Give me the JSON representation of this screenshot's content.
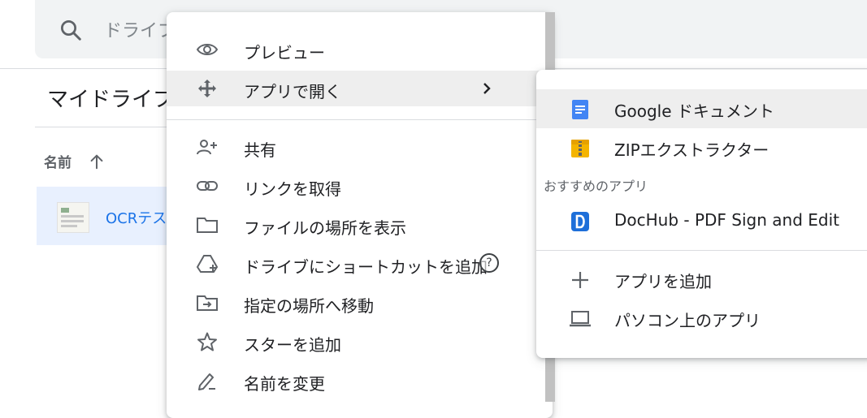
{
  "search": {
    "placeholder": "ドライブ"
  },
  "page": {
    "title": "マイドライブ"
  },
  "list": {
    "column_name": "名前",
    "files": [
      {
        "name": "OCRテスト"
      }
    ]
  },
  "context_menu": {
    "items": [
      {
        "label": "プレビュー",
        "icon": "eye-icon"
      },
      {
        "label": "アプリで開く",
        "icon": "move-icon",
        "submenu_arrow": "›"
      },
      {
        "label": "共有",
        "icon": "person-add-icon"
      },
      {
        "label": "リンクを取得",
        "icon": "link-icon"
      },
      {
        "label": "ファイルの場所を表示",
        "icon": "folder-icon"
      },
      {
        "label": "ドライブにショートカットを追加",
        "icon": "drive-shortcut-icon",
        "badge": "?"
      },
      {
        "label": "指定の場所へ移動",
        "icon": "folder-move-icon"
      },
      {
        "label": "スターを追加",
        "icon": "star-icon"
      },
      {
        "label": "名前を変更",
        "icon": "pencil-icon"
      }
    ]
  },
  "submenu": {
    "apps": [
      {
        "label": "Google ドキュメント",
        "icon": "google-docs-icon"
      },
      {
        "label": "ZIPエクストラクター",
        "icon": "zip-extractor-icon"
      }
    ],
    "suggested_heading": "おすすめのアプリ",
    "suggested": [
      {
        "label": "DocHub - PDF Sign and Edit",
        "icon": "dochub-icon"
      }
    ],
    "actions": [
      {
        "label": "アプリを追加",
        "icon": "plus-icon"
      },
      {
        "label": "パソコン上のアプリ",
        "icon": "laptop-icon"
      }
    ]
  },
  "colors": {
    "accent": "#1a73e8",
    "hover": "#eeeeee",
    "icon_gray": "#5f6368",
    "selected_row": "#e8f0fe"
  }
}
